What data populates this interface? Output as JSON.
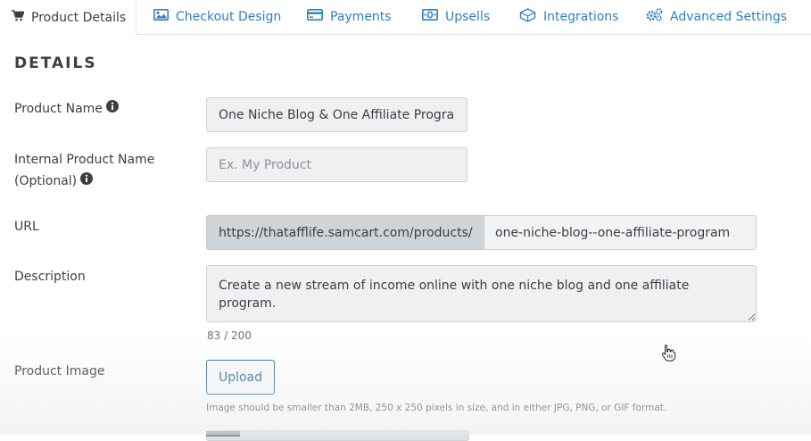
{
  "tabs": [
    {
      "label": "Product Details",
      "icon": "cart-icon",
      "active": true
    },
    {
      "label": "Checkout Design",
      "icon": "image-icon",
      "active": false
    },
    {
      "label": "Payments",
      "icon": "credit-card-icon",
      "active": false
    },
    {
      "label": "Upsells",
      "icon": "money-icon",
      "active": false
    },
    {
      "label": "Integrations",
      "icon": "cube-icon",
      "active": false
    },
    {
      "label": "Advanced Settings",
      "icon": "gears-icon",
      "active": false
    }
  ],
  "section_title": "DETAILS",
  "product_name": {
    "label": "Product Name",
    "value": "One Niche Blog & One Affiliate Program"
  },
  "internal_name": {
    "label_line1": "Internal Product Name",
    "label_line2": "(Optional)",
    "placeholder": "Ex. My Product"
  },
  "url": {
    "label": "URL",
    "prefix": "https://thatafflife.samcart.com/products/",
    "slug": "one-niche-blog--one-affiliate-program"
  },
  "description": {
    "label": "Description",
    "value": "Create a new stream of income online with one niche blog and one affiliate program.",
    "counter": "83 / 200"
  },
  "product_image": {
    "label": "Product Image",
    "button": "Upload",
    "hint": "Image should be smaller than 2MB, 250 x 250 pixels in size, and in either JPG, PNG, or GIF format."
  },
  "colors": {
    "tab_link": "#2d7fc1",
    "text": "#3a3f45",
    "field_bg": "#eef0f2",
    "url_prefix_bg": "#cfd4d9",
    "upload_border": "#2d6f95"
  }
}
